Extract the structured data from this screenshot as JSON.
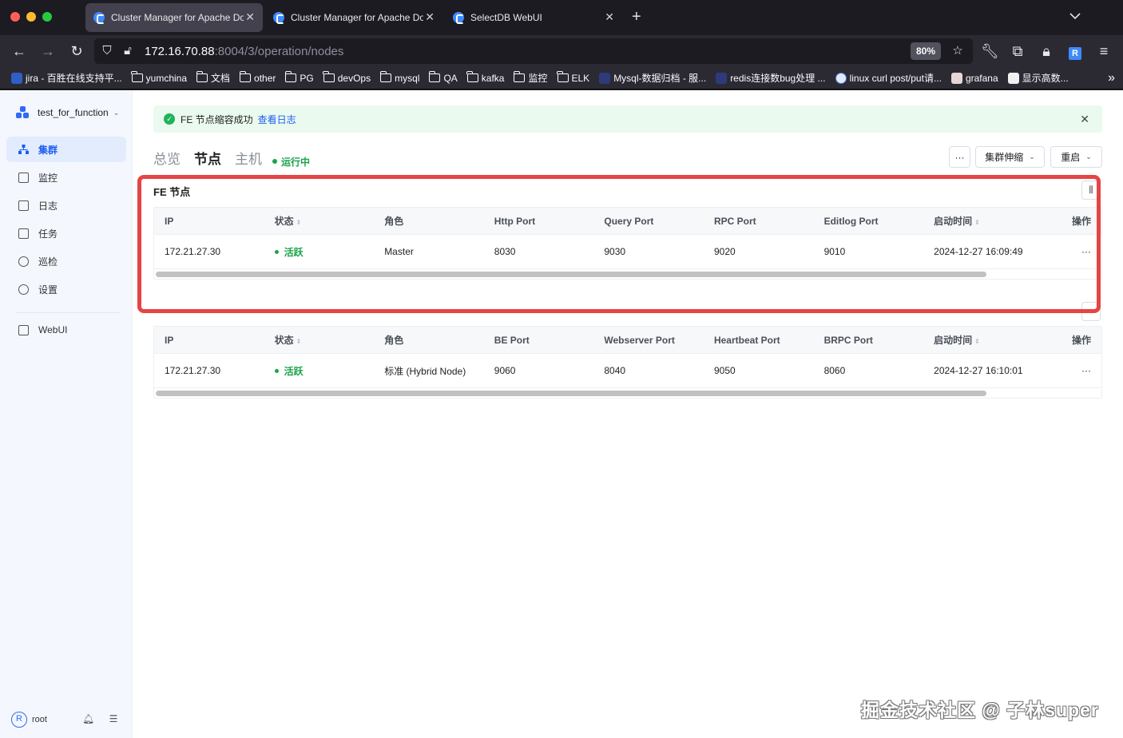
{
  "browser": {
    "tabs": [
      {
        "title": "Cluster Manager for Apache Doris",
        "active": true
      },
      {
        "title": "Cluster Manager for Apache Doris",
        "active": false
      },
      {
        "title": "SelectDB WebUI",
        "active": false
      }
    ],
    "url_host": "172.16.70.88",
    "url_rest": ":8004/3/operation/nodes",
    "zoom": "80%",
    "bookmarks": [
      "jira - 百胜在线支持平...",
      "yumchina",
      "文档",
      "other",
      "PG",
      "devOps",
      "mysql",
      "QA",
      "kafka",
      "监控",
      "ELK",
      "Mysql-数据归档 - 服...",
      "redis连接数bug处理 ...",
      "linux curl post/put请...",
      "grafana",
      "显示高数..."
    ]
  },
  "sidebar": {
    "project": "test_for_function",
    "items": [
      {
        "label": "集群",
        "icon": "cluster-icon"
      },
      {
        "label": "监控",
        "icon": "monitor-icon"
      },
      {
        "label": "日志",
        "icon": "log-icon"
      },
      {
        "label": "任务",
        "icon": "task-icon"
      },
      {
        "label": "巡检",
        "icon": "inspect-icon"
      },
      {
        "label": "设置",
        "icon": "settings-icon"
      }
    ],
    "webui": "WebUI",
    "user": "root",
    "avatar_letter": "R"
  },
  "alert": {
    "text": "FE 节点缩容成功",
    "link": "查看日志"
  },
  "page_tabs": [
    "总览",
    "节点",
    "主机"
  ],
  "status": "运行中",
  "toolbar": {
    "more": "···",
    "scale": "集群伸缩",
    "restart": "重启"
  },
  "fe": {
    "title": "FE 节点",
    "columns": [
      "IP",
      "状态",
      "角色",
      "Http Port",
      "Query Port",
      "RPC Port",
      "Editlog Port",
      "启动时间",
      "操作"
    ],
    "rows": [
      {
        "ip": "172.21.27.30",
        "status": "活跃",
        "role": "Master",
        "http_port": "8030",
        "query_port": "9030",
        "rpc_port": "9020",
        "editlog_port": "9010",
        "start_time": "2024-12-27 16:09:49",
        "action": "···"
      }
    ]
  },
  "be": {
    "columns": [
      "IP",
      "状态",
      "角色",
      "BE Port",
      "Webserver Port",
      "Heartbeat Port",
      "BRPC Port",
      "启动时间",
      "操作"
    ],
    "rows": [
      {
        "ip": "172.21.27.30",
        "status": "活跃",
        "role": "标准 (Hybrid Node)",
        "be_port": "9060",
        "webserver_port": "8040",
        "heartbeat_port": "9050",
        "brpc_port": "8060",
        "start_time": "2024-12-27 16:10:01",
        "action": "···"
      }
    ]
  },
  "watermark": "掘金技术社区 @ 子林super",
  "colors": {
    "accent": "#1c5df2",
    "success": "#1aa34a",
    "highlight": "#e54545"
  }
}
